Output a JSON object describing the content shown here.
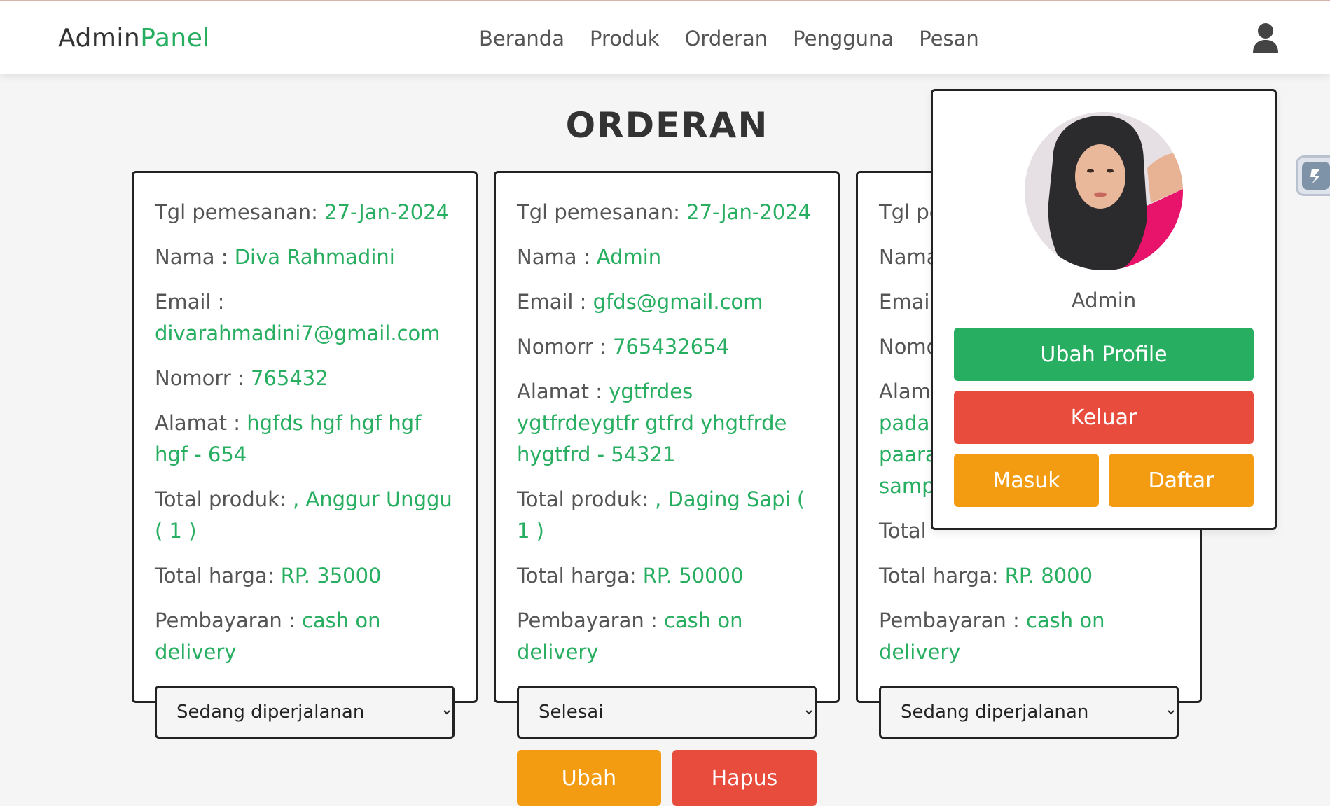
{
  "header": {
    "logo_main": "Admin",
    "logo_accent": "Panel",
    "nav": [
      "Beranda",
      "Produk",
      "Orderan",
      "Pengguna",
      "Pesan"
    ]
  },
  "page_title": "ORDERAN",
  "labels": {
    "date": "Tgl pemesanan: ",
    "name": "Nama : ",
    "email": "Email : ",
    "phone": "Nomorr : ",
    "address": "Alamat : ",
    "products": "Total produk: ",
    "price": "Total harga: ",
    "payment": "Pembayaran : "
  },
  "orders": [
    {
      "date": "27-Jan-2024",
      "name": "Diva Rahmadini",
      "email": "divarahmadini7@gmail.com",
      "phone": "765432",
      "address": "hgfds hgf hgf hgf hgf - 654",
      "products": ", Anggur Unggu ( 1 )",
      "price": "RP. 35000",
      "payment": "cash on delivery",
      "status": "Sedang diperjalanan"
    },
    {
      "date": "27-Jan-2024",
      "name": "Admin",
      "email": "gfds@gmail.com",
      "phone": "765432654",
      "address": "ygtfrdes ygtfrdeygtfr gtfrd yhgtfrde hygtfrd - 54321",
      "products": ", Daging Sapi ( 1 )",
      "price": "RP. 50000",
      "payment": "cash on delivery",
      "status": "Selesai"
    },
    {
      "date_partial": "Tgl pe",
      "name_partial": "Nama",
      "email_partial": "Email",
      "phone_partial": "Nomo",
      "address_partial": "Alama",
      "address_lines_partial": [
        "padar",
        "paara",
        "samp"
      ],
      "total_partial": "Total",
      "price": "RP. 8000",
      "payment": "cash on delivery",
      "status": "Sedang diperjalanan"
    }
  ],
  "buttons": {
    "update": "Ubah",
    "delete": "Hapus"
  },
  "profile": {
    "name": "Admin",
    "edit": "Ubah Profile",
    "logout": "Keluar",
    "login": "Masuk",
    "register": "Daftar"
  },
  "colors": {
    "accent_green": "#27ae60",
    "orange": "#f39c12",
    "red": "#e74c3c"
  }
}
